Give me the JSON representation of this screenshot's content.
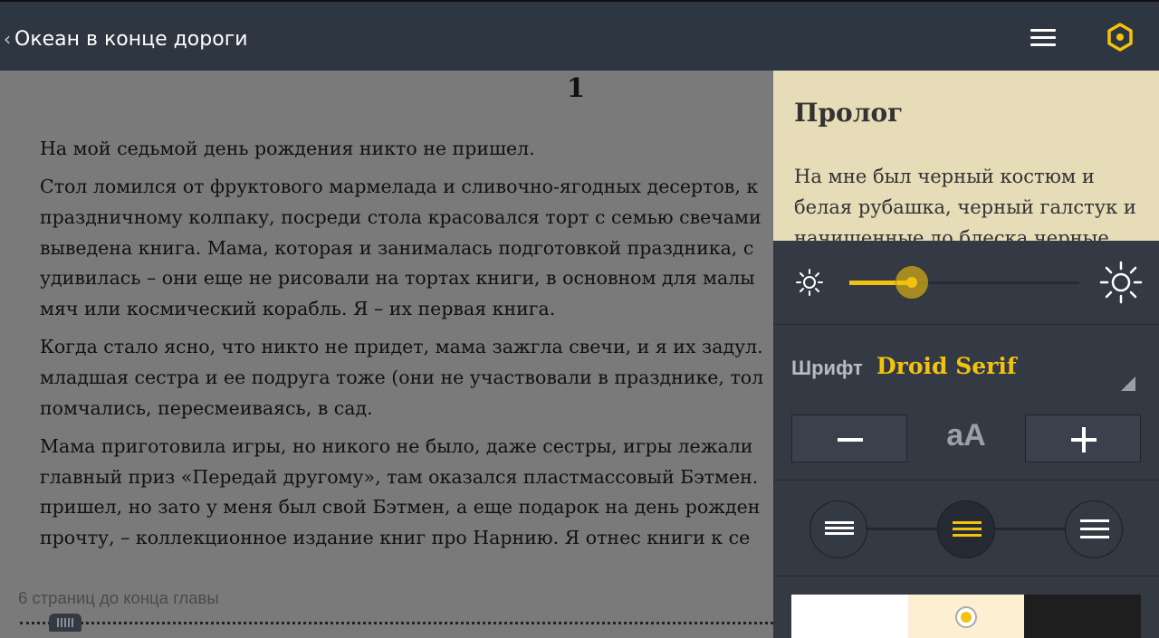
{
  "header": {
    "back_glyph": "‹",
    "book_title": "Океан в конце дороги",
    "menu_icon": "menu-icon",
    "settings_icon": "gear-icon",
    "accent_color": "#f3c20e"
  },
  "reader": {
    "page_number": "1",
    "lines": [
      [
        "На мой седьмой день рождения никто не пришел."
      ],
      [
        "Стол ломился от фруктового мармелада и сливочно-ягодных десертов, к",
        "праздничному колпаку, посреди стола красовался торт с семью свечами",
        "выведена книга. Мама, которая и занималась подготовкой праздника, с",
        "удивилась – они еще не рисовали на тортах книги, в основном для малы",
        "мяч или космический корабль. Я – их первая книга."
      ],
      [
        "Когда стало ясно, что никто не придет, мама зажгла свечи, и я их задул.",
        "младшая сестра и ее подруга тоже (они не участвовали в празднике, тол",
        "помчались, пересмеиваясь, в сад."
      ],
      [
        "Мама приготовила игры, но никого не было, даже сестры, игры лежали",
        "главный приз «Передай другому», там оказался пластмассовый Бэтмен.",
        "пришел, но зато у меня был свой Бэтмен, а еще подарок на день рожден",
        "прочту, – коллекционное издание книг про Нарнию. Я отнес книги к се"
      ]
    ],
    "pages_left_text": "6 страниц до конца главы",
    "progress_fraction": 0.06
  },
  "preview": {
    "chapter_title": "Пролог",
    "text": "На мне был черный костюм и белая рубашка, черный галстук и начищенные до блеска черные"
  },
  "settings": {
    "brightness_fraction": 0.27,
    "brightness_low_icon": "sun-small-icon",
    "brightness_high_icon": "sun-large-icon",
    "font_label": "Шрифт",
    "font_value": "Droid Serif",
    "decrease_label": "−",
    "size_indicator": "aA",
    "increase_label": "+",
    "line_spacing_selected": "medium",
    "themes": [
      {
        "name": "white",
        "color": "#ffffff"
      },
      {
        "name": "sepia",
        "color": "#fdf0d2"
      },
      {
        "name": "black",
        "color": "#1e1e1e"
      }
    ],
    "selected_theme": "sepia"
  }
}
